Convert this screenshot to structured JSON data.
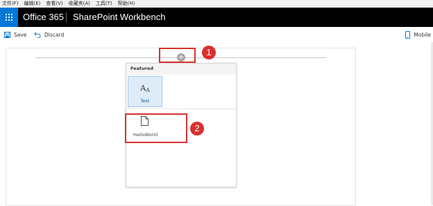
{
  "menubar": {
    "items": [
      "文件(F)",
      "编辑(E)",
      "查看(V)",
      "收藏夹(A)",
      "工具(T)",
      "帮助(H)"
    ]
  },
  "suitebar": {
    "brand": "Office 365",
    "app_title": "SharePoint Workbench",
    "accent": "#0078d7"
  },
  "commandbar": {
    "save_label": "Save",
    "discard_label": "Discard",
    "mobile_label": "Mobile"
  },
  "toolbox": {
    "section_title": "Featured",
    "text_tool": {
      "glyph": "AA",
      "label": "Text"
    },
    "custom_tool": {
      "label": "HelloWorld"
    }
  },
  "annotations": {
    "one": "1",
    "two": "2",
    "color": "#d9302f"
  },
  "canvas": {
    "add_symbol": "+"
  }
}
